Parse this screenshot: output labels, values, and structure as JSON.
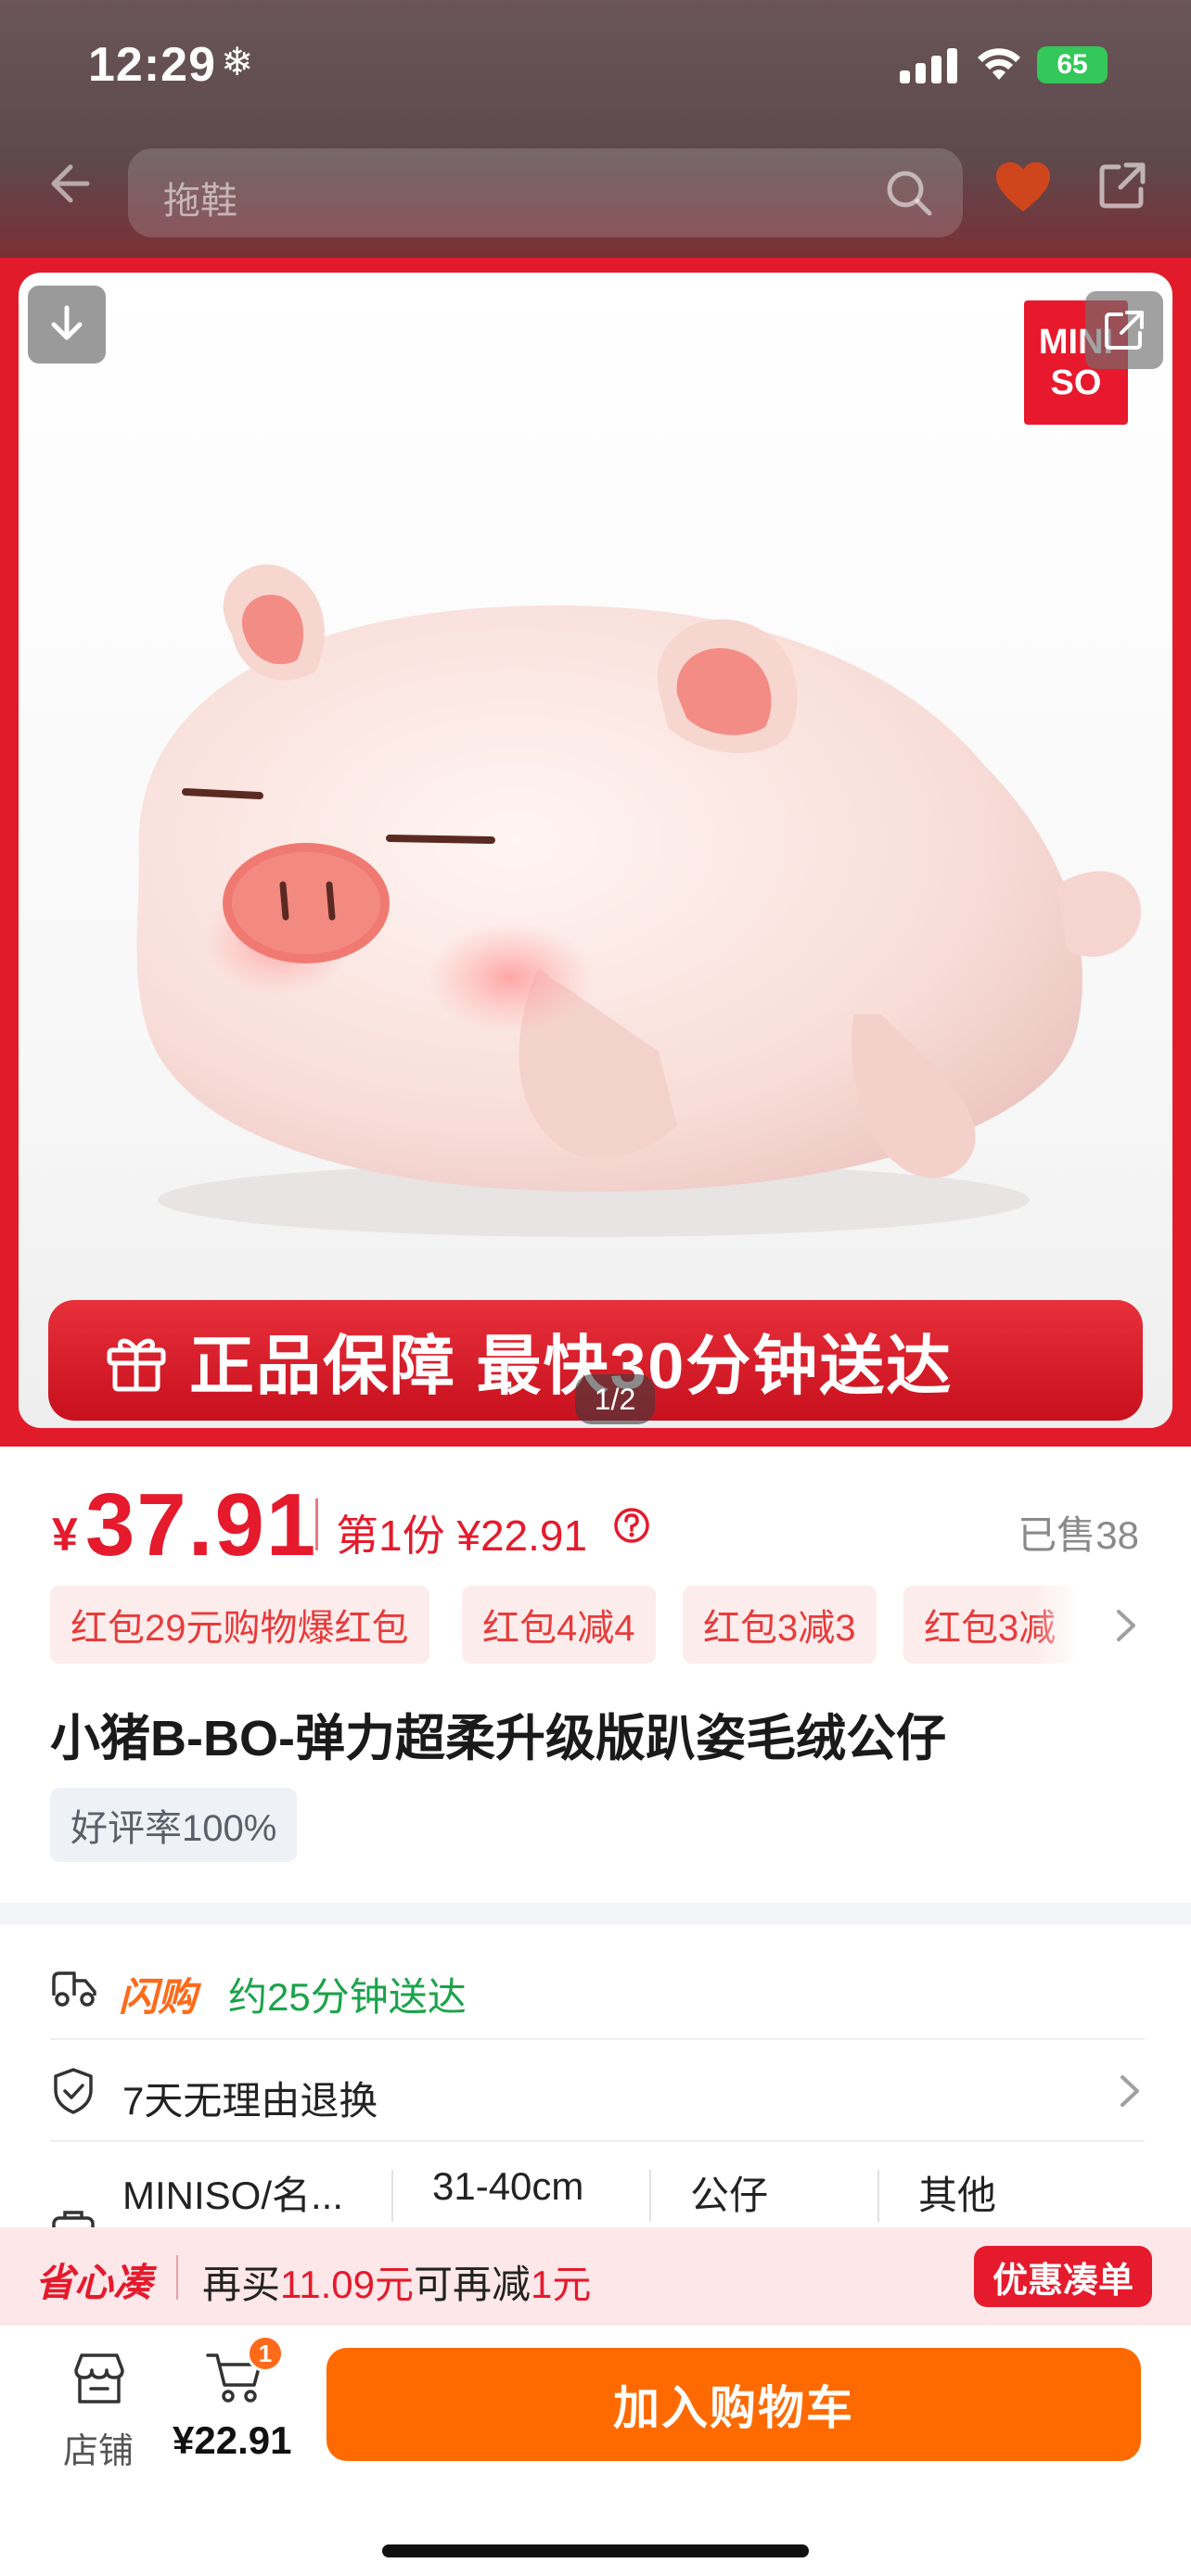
{
  "status_bar": {
    "time": "12:29",
    "battery": "65"
  },
  "nav": {
    "search_placeholder": "拖鞋"
  },
  "hero": {
    "brand_logo_line1": "MINI",
    "brand_logo_line2": "SO",
    "banner_text": "正品保障 最快30分钟送达",
    "page_indicator": "1/2"
  },
  "price": {
    "currency": "¥",
    "amount": "37.91",
    "first_item_label": "第1份 ¥22.91",
    "sold": "已售38"
  },
  "coupons": [
    "红包29元购物爆红包",
    "红包4减4",
    "红包3减3",
    "红包3减"
  ],
  "product": {
    "title": "小猪B-BO-弹力超柔升级版趴姿毛绒公仔",
    "rating_tag": "好评率100%"
  },
  "service": {
    "flash_label": "闪购",
    "delivery_text": "约25分钟送达",
    "return_text": "7天无理由退换"
  },
  "specs": [
    "MINISO/名...",
    "31-40cm",
    "公仔",
    "其他"
  ],
  "savings": {
    "logo": "省心凑",
    "text_prefix": "再买",
    "amount": "11.09元",
    "text_mid": "可再减",
    "discount": "1元",
    "button": "优惠凑单"
  },
  "bottom": {
    "store_label": "店铺",
    "cart_badge": "1",
    "cart_total": "¥22.91",
    "add_to_cart": "加入购物车"
  },
  "colors": {
    "accent_red": "#e51a2c",
    "accent_orange": "#ff6a00",
    "green": "#1aa34a"
  }
}
